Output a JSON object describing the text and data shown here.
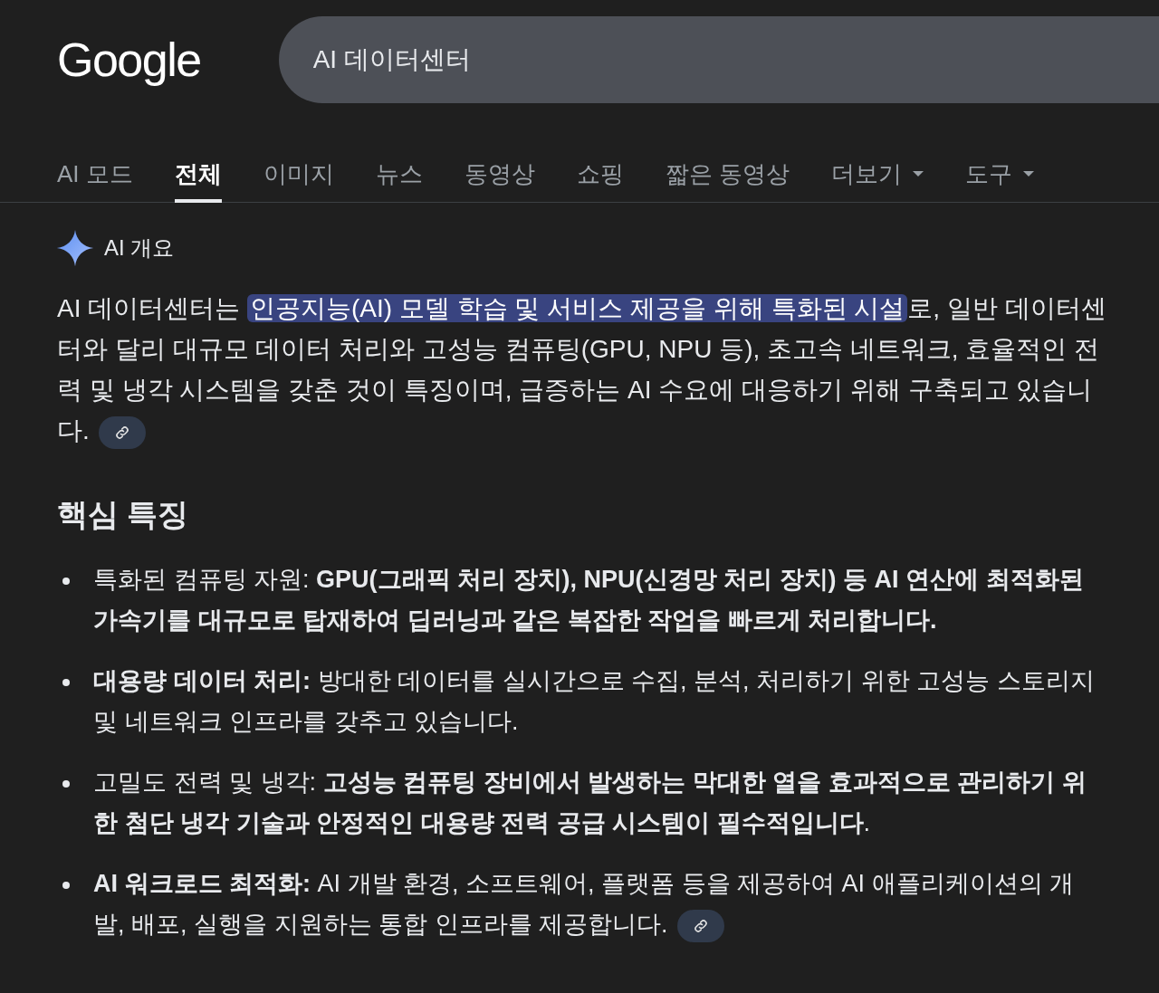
{
  "header": {
    "logo": "Google",
    "search": {
      "value": "AI 데이터센터"
    }
  },
  "tabs": [
    {
      "label": "AI 모드",
      "selected": false,
      "kind": "plain"
    },
    {
      "label": "전체",
      "selected": true,
      "kind": "plain"
    },
    {
      "label": "이미지",
      "selected": false,
      "kind": "plain"
    },
    {
      "label": "뉴스",
      "selected": false,
      "kind": "plain"
    },
    {
      "label": "동영상",
      "selected": false,
      "kind": "plain"
    },
    {
      "label": "쇼핑",
      "selected": false,
      "kind": "plain"
    },
    {
      "label": "짧은 동영상",
      "selected": false,
      "kind": "plain"
    },
    {
      "label": "더보기",
      "selected": false,
      "kind": "dropdown"
    },
    {
      "label": "도구",
      "selected": false,
      "kind": "dropdown"
    }
  ],
  "overview": {
    "title": "AI 개요",
    "summary": [
      {
        "text": "AI 데이터센터는 ",
        "highlighted": false
      },
      {
        "text": "인공지능(AI) 모델 학습 및 서비스 제공을 위해 특화된 시설",
        "highlighted": true
      },
      {
        "text": "로, 일반 데이터센터와 달리 대규모 데이터 처리와 고성능 컴퓨팅(GPU, NPU 등), 초고속 네트워크, 효율적인 전력 및 냉각 시스템을 갖춘 것이 특징이며, 급증하는 AI 수요에 대응하기 위해 구축되고 있습니다.",
        "highlighted": false
      }
    ],
    "summary_link": true,
    "heading": "핵심 특징",
    "items": [
      {
        "text": "특화된 컴퓨팅 자원: **GPU(그래픽 처리 장치), NPU(신경망 처리 장치) 등 AI 연산에 최적화된 가속기를 대규모로 탑재하여 딥러닝과 같은 복잡한 작업을 빠르게 처리합니다.**",
        "link": false
      },
      {
        "text": "**대용량 데이터 처리:** 방대한 데이터를 실시간으로 수집, 분석, 처리하기 위한 고성능 스토리지 및 네트워크 인프라를 갖추고 있습니다.",
        "link": false
      },
      {
        "text": "고밀도 전력 및 냉각: **고성능 컴퓨팅 장비에서 발생하는 막대한 열을 효과적으로 관리하기 위한 첨단 냉각 기술과 안정적인 대용량 전력 공급 시스템이 필수적입니다**.",
        "link": false
      },
      {
        "text": "**AI 워크로드 최적화:** AI 개발 환경, 소프트웨어, 플랫폼 등을 제공하여 AI 애플리케이션의 개발, 배포, 실행을 지원하는 통합 인프라를 제공합니다.",
        "link": true
      }
    ]
  }
}
